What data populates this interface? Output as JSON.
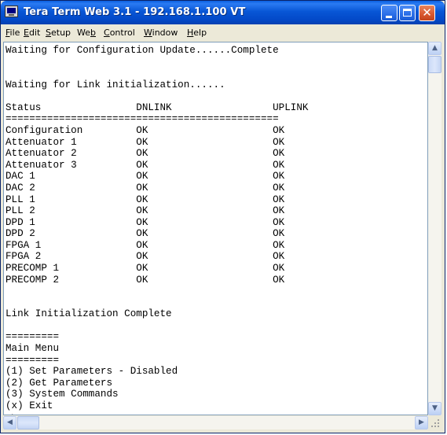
{
  "window": {
    "title": "Tera Term Web 3.1 - 192.168.1.100 VT",
    "close_glyph": "✕",
    "app_icon": "tera-term-monitor-icon"
  },
  "menu": [
    {
      "pre": "",
      "key": "F",
      "post": "ile"
    },
    {
      "pre": "",
      "key": "E",
      "post": "dit"
    },
    {
      "pre": "",
      "key": "S",
      "post": "etup"
    },
    {
      "pre": "We",
      "key": "b",
      "post": ""
    },
    {
      "pre": "",
      "key": "C",
      "post": "ontrol"
    },
    {
      "pre": "",
      "key": "W",
      "post": "indow"
    },
    {
      "pre": "",
      "key": "H",
      "post": "elp"
    }
  ],
  "terminal": {
    "lines": [
      "Waiting for Configuration Update......Complete",
      "",
      "",
      "Waiting for Link initialization......",
      "",
      "Status                DNLINK                 UPLINK",
      "==============================================",
      "Configuration         OK                     OK",
      "Attenuator 1          OK                     OK",
      "Attenuator 2          OK                     OK",
      "Attenuator 3          OK                     OK",
      "DAC 1                 OK                     OK",
      "DAC 2                 OK                     OK",
      "PLL 1                 OK                     OK",
      "PLL 2                 OK                     OK",
      "DPD 1                 OK                     OK",
      "DPD 2                 OK                     OK",
      "FPGA 1                OK                     OK",
      "FPGA 2                OK                     OK",
      "PRECOMP 1             OK                     OK",
      "PRECOMP 2             OK                     OK",
      "",
      "",
      "Link Initialization Complete",
      "",
      "=========",
      "Main Menu",
      "=========",
      "(1) Set Parameters - Disabled",
      "(2) Get Parameters",
      "(3) System Commands",
      "(x) Exit",
      "->"
    ]
  },
  "scrollbars": {
    "up_glyph": "▲",
    "down_glyph": "▼",
    "left_glyph": "◀",
    "right_glyph": "▶"
  }
}
